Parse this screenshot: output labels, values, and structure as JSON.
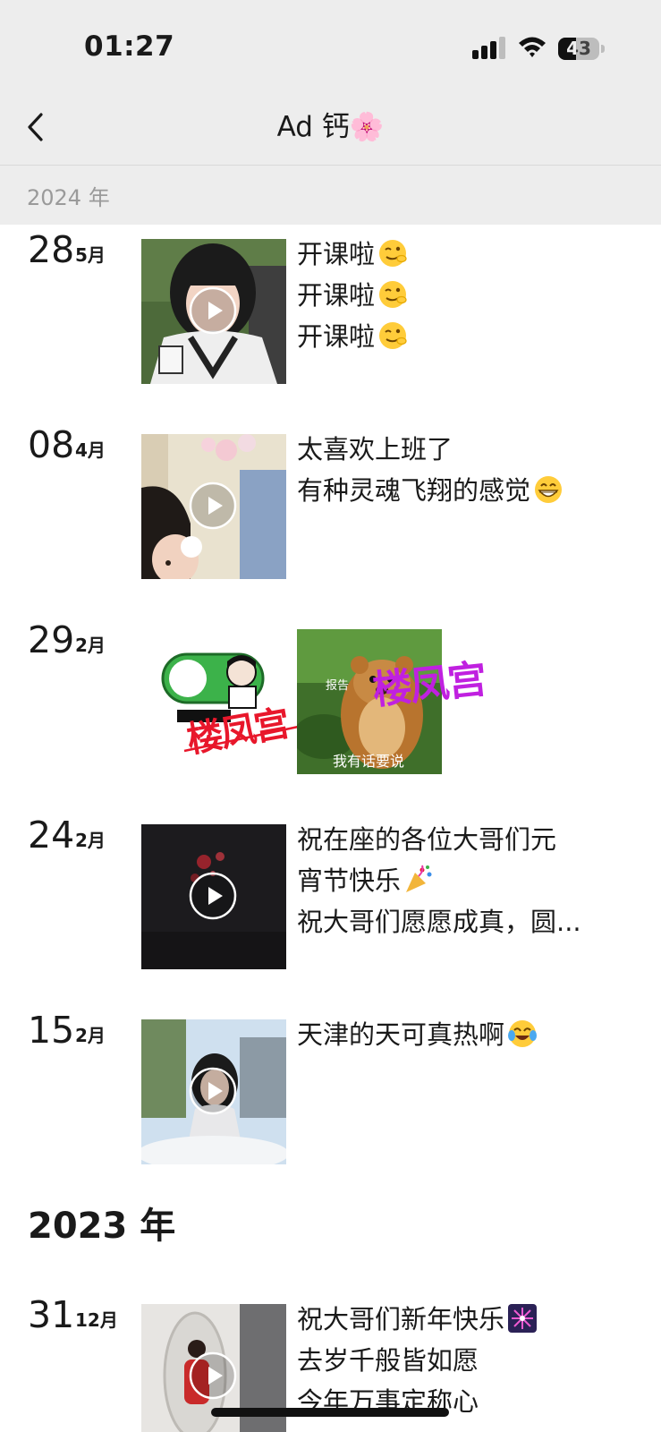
{
  "status_bar": {
    "time": "01:27",
    "battery": "43",
    "battery_level_percent": 43,
    "icons": [
      "signal-icon",
      "wifi-icon",
      "battery-icon"
    ]
  },
  "nav": {
    "back_icon": "chevron-left-icon",
    "title": "Ad 钙🌸"
  },
  "sticky_year": "2024 年",
  "year_2023": "2023 年",
  "posts": [
    {
      "day": "28",
      "month": "5月",
      "media": "video",
      "lines": [
        "开课啦",
        "开课啦",
        "开课啦"
      ],
      "emoji": "wink-face-emoji"
    },
    {
      "day": "08",
      "month": "4月",
      "media": "video",
      "lines": [
        "太喜欢上班了",
        "有种灵魂飞翔的感觉"
      ],
      "emoji": "grinning-face-emoji"
    },
    {
      "day": "29",
      "month": "2月",
      "media": "images",
      "sticker_1": {
        "watermark": "楼凤宫"
      },
      "sticker_2": {
        "label_top": "报告",
        "caption": "我有话要说",
        "watermark": "楼凤宫"
      }
    },
    {
      "day": "24",
      "month": "2月",
      "media": "video",
      "lines": [
        "祝在座的各位大哥们元",
        "宵节快乐",
        "祝大哥们愿愿成真，圆..."
      ],
      "emoji": "party-popper-emoji"
    },
    {
      "day": "15",
      "month": "2月",
      "media": "video",
      "lines": [
        "天津的天可真热啊"
      ],
      "emoji": "crying-laughing-emoji"
    },
    {
      "day": "31",
      "month": "12月",
      "media": "video",
      "lines": [
        "祝大哥们新年快乐",
        "去岁千般皆如愿",
        "今年万事定称心"
      ],
      "emoji": "fireworks-emoji"
    }
  ],
  "colors": {
    "header_bg": "#ededed",
    "page_bg": "#ffffff",
    "year_label_gray": "#9a9a9a",
    "watermark_red": "#e8172b",
    "watermark_purple": "#c020e0",
    "toggle_green": "#3cb24a"
  }
}
